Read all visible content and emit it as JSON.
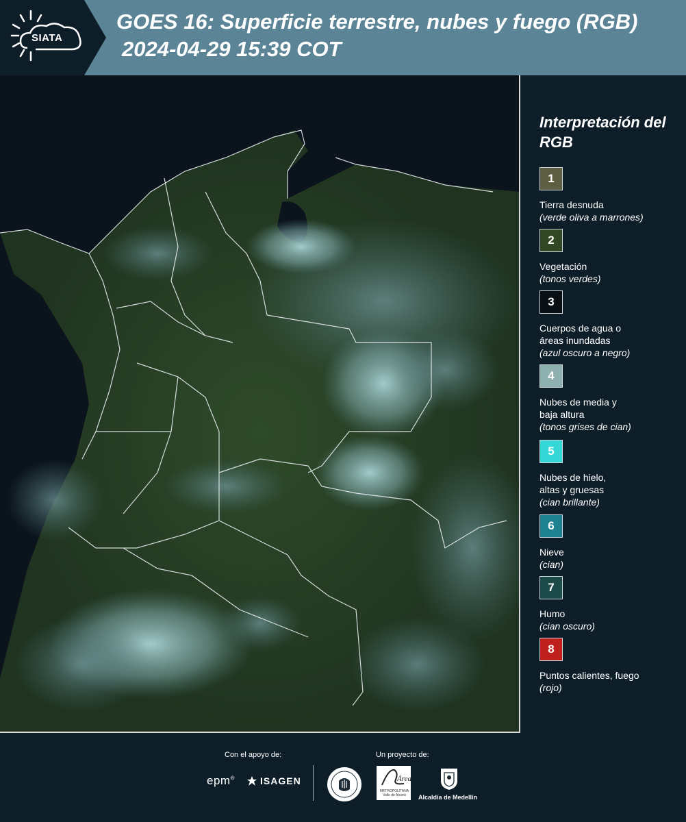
{
  "header": {
    "title": "GOES 16: Superficie terrestre, nubes y fuego (RGB)",
    "timestamp": "2024-04-29 15:39 COT",
    "logo_text": "SIATA",
    "logo_icon": "sun-cloud-icon"
  },
  "legend": {
    "title": "Interpretación del RGB",
    "items": [
      {
        "number": "1",
        "label": "Tierra desnuda",
        "note": "(verde oliva a marrones)",
        "color": "#5e5f42"
      },
      {
        "number": "2",
        "label": "Vegetación",
        "note": "(tonos verdes)",
        "color": "#314723"
      },
      {
        "number": "3",
        "label": "Cuerpos de agua o\náreas inundadas",
        "note": "(azul oscuro a negro)",
        "color": "#0a0f14"
      },
      {
        "number": "4",
        "label": "Nubes de media y\nbaja altura",
        "note": "(tonos grises de cian)",
        "color": "#8eb1b0"
      },
      {
        "number": "5",
        "label": "Nubes de hielo,\naltas y gruesas",
        "note": "(cian brillante)",
        "color": "#35d6d6"
      },
      {
        "number": "6",
        "label": "Nieve",
        "note": "(cian)",
        "color": "#1e8190"
      },
      {
        "number": "7",
        "label": "Humo",
        "note": "(cian oscuro)",
        "color": "#1c4b4a"
      },
      {
        "number": "8",
        "label": "Puntos calientes, fuego",
        "note": "(rojo)",
        "color": "#c0201d"
      }
    ]
  },
  "footer": {
    "support_label": "Con el apoyo de:",
    "project_label": "Un proyecto de:",
    "epm": "epm",
    "isagen": "ISAGEN",
    "area_name": "Área",
    "area_subtitle": "METROPOLITANA Valle de Aburrá",
    "alcaldia": "Alcaldía de Medellín"
  },
  "colors": {
    "header_bg": "#5b8597",
    "page_bg": "#0e1e29"
  }
}
